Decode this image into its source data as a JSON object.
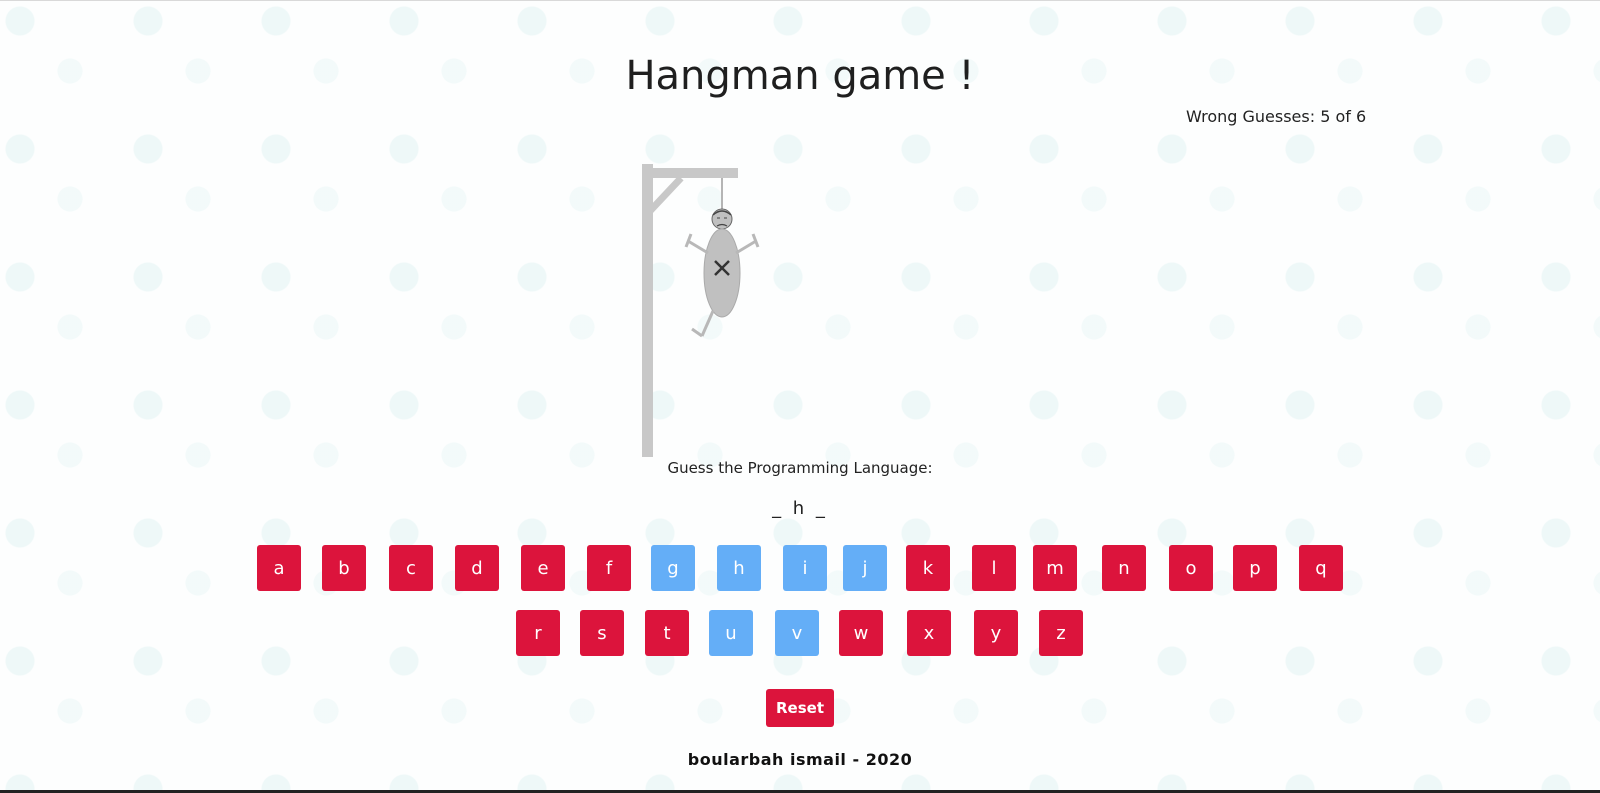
{
  "title": "Hangman game !",
  "wrong_guesses": "Wrong Guesses: 5 of 6",
  "prompt": "Guess the Programming Language:",
  "word_display": "_ h _",
  "keyboard": {
    "row1": [
      {
        "letter": "a",
        "used": false
      },
      {
        "letter": "b",
        "used": false
      },
      {
        "letter": "c",
        "used": false
      },
      {
        "letter": "d",
        "used": false
      },
      {
        "letter": "e",
        "used": false
      },
      {
        "letter": "f",
        "used": false
      },
      {
        "letter": "g",
        "used": true
      },
      {
        "letter": "h",
        "used": true
      },
      {
        "letter": "i",
        "used": true
      },
      {
        "letter": "j",
        "used": true
      },
      {
        "letter": "k",
        "used": false
      },
      {
        "letter": "l",
        "used": false
      },
      {
        "letter": "m",
        "used": false
      },
      {
        "letter": "n",
        "used": false
      },
      {
        "letter": "o",
        "used": false
      },
      {
        "letter": "p",
        "used": false
      },
      {
        "letter": "q",
        "used": false
      }
    ],
    "row2": [
      {
        "letter": "r",
        "used": false
      },
      {
        "letter": "s",
        "used": false
      },
      {
        "letter": "t",
        "used": false
      },
      {
        "letter": "u",
        "used": true
      },
      {
        "letter": "v",
        "used": true
      },
      {
        "letter": "w",
        "used": false
      },
      {
        "letter": "x",
        "used": false
      },
      {
        "letter": "y",
        "used": false
      },
      {
        "letter": "z",
        "used": false
      }
    ]
  },
  "reset_label": "Reset",
  "footer": "boularbah ismail - 2020",
  "colors": {
    "key_available": "#dc143c",
    "key_used": "#64aef7",
    "gallows": "#c8c8c8"
  }
}
